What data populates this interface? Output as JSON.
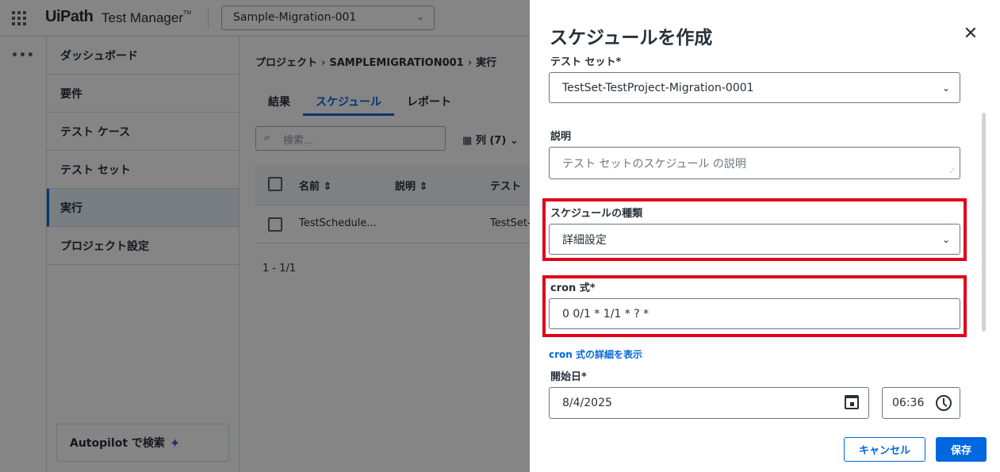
{
  "app": {
    "logo": "UiPath",
    "product": "Test Manager",
    "trademark": "TM",
    "project_selector": "Sample-Migration-001"
  },
  "sidebar": {
    "items": [
      {
        "label": "ダッシュボード"
      },
      {
        "label": "要件"
      },
      {
        "label": "テスト ケース"
      },
      {
        "label": "テスト セット"
      },
      {
        "label": "実行",
        "active": true
      },
      {
        "label": "プロジェクト設定"
      }
    ],
    "autopilot_label": "Autopilot で検索"
  },
  "breadcrumb": [
    "プロジェクト",
    "SAMPLEMIGRATION001",
    "実行"
  ],
  "tabs": [
    {
      "label": "結果"
    },
    {
      "label": "スケジュール",
      "active": true
    },
    {
      "label": "レポート"
    }
  ],
  "toolbar": {
    "search_placeholder": "検索...",
    "columns_label": "列 (7)"
  },
  "table": {
    "headers": [
      "名前",
      "説明",
      "テスト"
    ],
    "rows": [
      {
        "name": "TestSchedule...",
        "description": "",
        "testset": "TestSet-"
      }
    ],
    "pager": "1 - 1/1"
  },
  "drawer": {
    "title": "スケジュールを作成",
    "testset_label": "テスト セット*",
    "testset_value": "TestSet-TestProject-Migration-0001",
    "description_label": "説明",
    "description_placeholder": "テスト セットのスケジュール の説明",
    "schedule_type_label": "スケジュールの種類",
    "schedule_type_value": "詳細設定",
    "cron_label": "cron 式*",
    "cron_value": "0 0/1 * 1/1 * ? *",
    "cron_link": "cron 式の詳細を表示",
    "start_date_label": "開始日*",
    "start_date_value": "8/4/2025",
    "start_time_value": "06:36",
    "cancel_label": "キャンセル",
    "save_label": "保存"
  },
  "colors": {
    "accent": "#0067df",
    "highlight": "#e1001a",
    "overlay": "rgba(0,0,0,0.48)"
  }
}
